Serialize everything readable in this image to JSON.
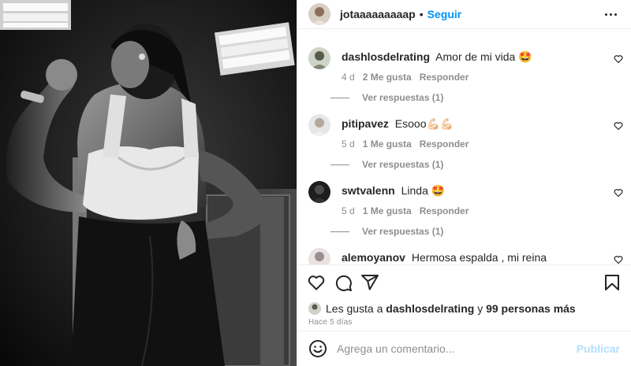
{
  "header": {
    "username": "jotaaaaaaaaap",
    "separator": "•",
    "follow_label": "Seguir",
    "more_icon": "more-horizontal-icon"
  },
  "comments": [
    {
      "username": "dashlosdelrating",
      "text": "Amor de mi vida 🤩",
      "age": "4 d",
      "likes": "2 Me gusta",
      "reply_label": "Responder",
      "replies_label": "Ver respuestas (1)"
    },
    {
      "username": "pitipavez",
      "text": "Esooo💪🏻💪🏻",
      "age": "5 d",
      "likes": "1 Me gusta",
      "reply_label": "Responder",
      "replies_label": "Ver respuestas (1)"
    },
    {
      "username": "swtvalenn",
      "text": "Linda 🤩",
      "age": "5 d",
      "likes": "1 Me gusta",
      "reply_label": "Responder",
      "replies_label": "Ver respuestas (1)"
    },
    {
      "username": "alemoyanov",
      "text": "Hermosa espalda , mi reina"
    }
  ],
  "actions": {
    "like_icon": "heart-icon",
    "comment_icon": "comment-icon",
    "share_icon": "share-icon",
    "save_icon": "bookmark-icon"
  },
  "likes": {
    "prefix": "Les gusta a",
    "first_user": "dashlosdelrating",
    "connector": "y",
    "others": "99 personas más"
  },
  "post_date": "Hace 5 días",
  "add_comment": {
    "emoji_icon": "emoji-icon",
    "placeholder": "Agrega un comentario...",
    "publish_label": "Publicar"
  },
  "colors": {
    "accent": "#0095f6",
    "publish_disabled": "#b2dffc",
    "muted": "#8e8e8e",
    "text": "#262626"
  }
}
